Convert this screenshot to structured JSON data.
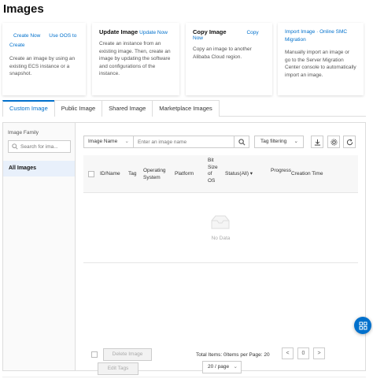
{
  "page": {
    "title": "Images"
  },
  "cards": {
    "custom": {
      "create_now": "Create Now",
      "use_oos": "Use OOS to Create",
      "desc": "Create an image by using an existing ECS instance or a snapshot."
    },
    "update": {
      "title": "Update Image",
      "link": "Update Now",
      "desc": "Create an instance from an existing image. Then, create an image by updating the software and configurations of the instance."
    },
    "copy": {
      "title": "Copy Image",
      "link": "Copy Now",
      "desc": "Copy an image to another Alibaba Cloud region."
    },
    "import": {
      "link": "Import Image",
      "sep": " · ",
      "link2": "Online SMC Migration",
      "desc": "Manually import an image or go to the Server Migration Center console to automatically import an image."
    }
  },
  "tabs": [
    "Custom Image",
    "Public Image",
    "Shared Image",
    "Marketplace Images"
  ],
  "sidebar": {
    "label": "Image Family",
    "search_placeholder": "Search for ima...",
    "item": "All Images"
  },
  "filter": {
    "select_label": "Image Name",
    "input_placeholder": "Enter an image name",
    "tag_filter": "Tag filtering"
  },
  "table": {
    "headers": {
      "id_name": "ID/Name",
      "tag": "Tag",
      "os": "Operating System",
      "platform": "Platform",
      "bit": "Bit Size of OS",
      "status": "Status(All)",
      "progress": "Progress",
      "created": "Creation Time"
    },
    "empty": "No Data"
  },
  "footer": {
    "delete": "Delete Image",
    "edit_tags": "Edit Tags",
    "total": "Total Items: 0",
    "per_page_label": "Items per Page: 20",
    "prev": "<",
    "page": "0",
    "next": ">",
    "page_size": "20 / page"
  }
}
